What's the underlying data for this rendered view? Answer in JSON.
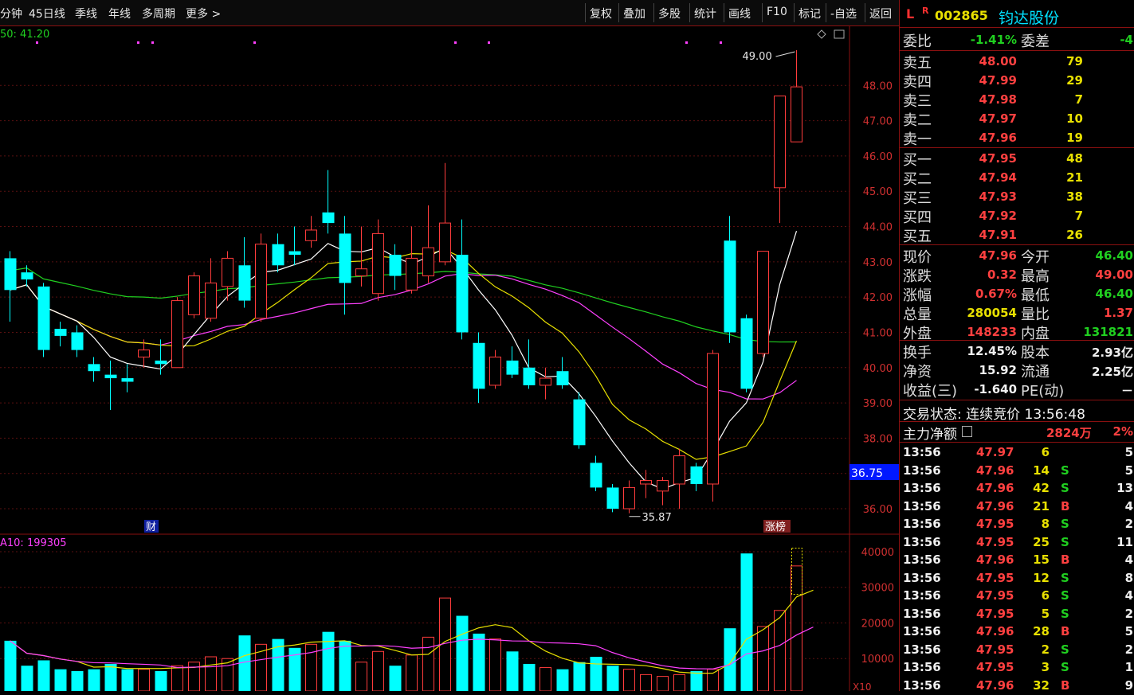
{
  "toolbar": {
    "left": [
      "分钟",
      "45日线",
      "季线",
      "年线",
      "多周期",
      "更多 >"
    ],
    "right": [
      "复权",
      "叠加",
      "多股",
      "统计",
      "画线",
      "F10",
      "标记",
      "-自选",
      "返回"
    ]
  },
  "chart": {
    "ma_label": "50: 41.20",
    "vol_label": "A10: 199305",
    "high_label": "49.00",
    "low_label": "35.87",
    "price_axis": [
      "48.00",
      "47.00",
      "46.00",
      "45.00",
      "44.00",
      "43.00",
      "42.00",
      "41.00",
      "40.00",
      "39.00",
      "38.00",
      "37.00",
      "36.00"
    ],
    "current_price_tag": "36.75",
    "vol_axis": [
      "40000",
      "30000",
      "20000",
      "10000"
    ],
    "vol_unit": "X10",
    "tag_cai": "财",
    "tag_zhangbang": "涨榜"
  },
  "chart_data": {
    "type": "candlestick",
    "candles": [
      {
        "o": 43.1,
        "c": 42.2,
        "h": 43.3,
        "l": 41.3
      },
      {
        "o": 42.7,
        "c": 42.5,
        "h": 42.9,
        "l": 42.3
      },
      {
        "o": 42.3,
        "c": 40.5,
        "h": 42.4,
        "l": 40.3
      },
      {
        "o": 41.1,
        "c": 40.9,
        "h": 41.3,
        "l": 40.6
      },
      {
        "o": 41.0,
        "c": 40.5,
        "h": 41.2,
        "l": 40.3
      },
      {
        "o": 40.1,
        "c": 39.9,
        "h": 40.3,
        "l": 39.6
      },
      {
        "o": 39.8,
        "c": 39.7,
        "h": 40.2,
        "l": 38.8
      },
      {
        "o": 39.7,
        "c": 39.6,
        "h": 40.1,
        "l": 39.3
      },
      {
        "o": 40.3,
        "c": 40.5,
        "h": 40.8,
        "l": 40.0
      },
      {
        "o": 40.2,
        "c": 40.1,
        "h": 40.8,
        "l": 39.8
      },
      {
        "o": 40.0,
        "c": 41.9,
        "h": 42.0,
        "l": 40.0
      },
      {
        "o": 41.5,
        "c": 42.6,
        "h": 42.7,
        "l": 41.4
      },
      {
        "o": 41.4,
        "c": 42.4,
        "h": 43.1,
        "l": 41.3
      },
      {
        "o": 42.3,
        "c": 43.1,
        "h": 43.3,
        "l": 41.9
      },
      {
        "o": 42.9,
        "c": 41.9,
        "h": 43.7,
        "l": 41.7
      },
      {
        "o": 41.4,
        "c": 43.5,
        "h": 43.8,
        "l": 41.3
      },
      {
        "o": 43.5,
        "c": 42.9,
        "h": 43.8,
        "l": 42.7
      },
      {
        "o": 43.3,
        "c": 43.2,
        "h": 44.0,
        "l": 42.9
      },
      {
        "o": 43.6,
        "c": 43.9,
        "h": 44.3,
        "l": 43.4
      },
      {
        "o": 44.4,
        "c": 44.1,
        "h": 45.6,
        "l": 43.8
      },
      {
        "o": 43.8,
        "c": 42.4,
        "h": 44.3,
        "l": 41.5
      },
      {
        "o": 42.6,
        "c": 42.8,
        "h": 44.0,
        "l": 42.3
      },
      {
        "o": 42.1,
        "c": 43.8,
        "h": 44.2,
        "l": 41.9
      },
      {
        "o": 43.2,
        "c": 42.6,
        "h": 43.5,
        "l": 42.2
      },
      {
        "o": 42.2,
        "c": 43.1,
        "h": 44.0,
        "l": 42.1
      },
      {
        "o": 42.6,
        "c": 43.4,
        "h": 44.6,
        "l": 42.4
      },
      {
        "o": 43.0,
        "c": 44.1,
        "h": 45.8,
        "l": 42.9
      },
      {
        "o": 43.2,
        "c": 41.0,
        "h": 44.2,
        "l": 40.8
      },
      {
        "o": 40.7,
        "c": 39.4,
        "h": 41.0,
        "l": 39.0
      },
      {
        "o": 39.5,
        "c": 40.3,
        "h": 40.5,
        "l": 39.4
      },
      {
        "o": 40.2,
        "c": 39.8,
        "h": 40.6,
        "l": 39.7
      },
      {
        "o": 40.0,
        "c": 39.5,
        "h": 40.8,
        "l": 39.4
      },
      {
        "o": 39.5,
        "c": 39.7,
        "h": 40.0,
        "l": 39.1
      },
      {
        "o": 39.9,
        "c": 39.5,
        "h": 40.3,
        "l": 39.4
      },
      {
        "o": 39.1,
        "c": 37.8,
        "h": 39.3,
        "l": 37.7
      },
      {
        "o": 37.3,
        "c": 36.6,
        "h": 37.5,
        "l": 36.5
      },
      {
        "o": 36.6,
        "c": 36.0,
        "h": 36.7,
        "l": 35.9
      },
      {
        "o": 36.0,
        "c": 36.6,
        "h": 36.8,
        "l": 35.87
      },
      {
        "o": 36.7,
        "c": 36.8,
        "h": 37.1,
        "l": 36.3
      },
      {
        "o": 36.5,
        "c": 36.8,
        "h": 36.9,
        "l": 36.1
      },
      {
        "o": 36.7,
        "c": 37.5,
        "h": 37.7,
        "l": 36.0
      },
      {
        "o": 37.2,
        "c": 36.7,
        "h": 37.3,
        "l": 36.5
      },
      {
        "o": 36.7,
        "c": 40.4,
        "h": 40.5,
        "l": 36.2
      },
      {
        "o": 43.6,
        "c": 41.0,
        "h": 44.3,
        "l": 40.7
      },
      {
        "o": 41.4,
        "c": 39.4,
        "h": 41.5,
        "l": 39.3
      },
      {
        "o": 40.4,
        "c": 43.3,
        "h": 43.3,
        "l": 40.3
      },
      {
        "o": 45.1,
        "c": 47.7,
        "h": 47.7,
        "l": 44.1
      },
      {
        "o": 46.4,
        "c": 47.96,
        "h": 49.0,
        "l": 46.4
      }
    ],
    "volumes": [
      15000,
      8000,
      9500,
      7000,
      6500,
      7000,
      8500,
      7000,
      7000,
      6500,
      8000,
      9000,
      10500,
      10000,
      16500,
      14000,
      15500,
      13000,
      14000,
      17500,
      15000,
      9000,
      12000,
      8000,
      11000,
      16000,
      27000,
      22000,
      17000,
      15500,
      12000,
      8500,
      7500,
      7000,
      9000,
      10500,
      8000,
      7000,
      5500,
      5000,
      5500,
      6500,
      7000,
      18500,
      39500,
      19000,
      23500,
      36000,
      28000
    ],
    "ylim": [
      35.5,
      49.5
    ],
    "vol_ylim": [
      0,
      42000
    ]
  },
  "panel": {
    "header_l": "L",
    "header_r": "R",
    "code": "002865",
    "name": "钧达股份",
    "weibi_label": "委比",
    "weibi_value": "-1.41%",
    "weicha_label": "委差",
    "weicha_value": "-4",
    "sells": [
      {
        "label": "卖五",
        "price": "48.00",
        "vol": "79"
      },
      {
        "label": "卖四",
        "price": "47.99",
        "vol": "29"
      },
      {
        "label": "卖三",
        "price": "47.98",
        "vol": "7"
      },
      {
        "label": "卖二",
        "price": "47.97",
        "vol": "10"
      },
      {
        "label": "卖一",
        "price": "47.96",
        "vol": "19"
      }
    ],
    "buys": [
      {
        "label": "买一",
        "price": "47.95",
        "vol": "48"
      },
      {
        "label": "买二",
        "price": "47.94",
        "vol": "21"
      },
      {
        "label": "买三",
        "price": "47.93",
        "vol": "38"
      },
      {
        "label": "买四",
        "price": "47.92",
        "vol": "7"
      },
      {
        "label": "买五",
        "price": "47.91",
        "vol": "26"
      }
    ],
    "stats": [
      {
        "l1": "现价",
        "v1": "47.96",
        "c1": "red",
        "l2": "今开",
        "v2": "46.40",
        "c2": "grn"
      },
      {
        "l1": "涨跌",
        "v1": "0.32",
        "c1": "red",
        "l2": "最高",
        "v2": "49.00",
        "c2": "red"
      },
      {
        "l1": "涨幅",
        "v1": "0.67%",
        "c1": "red",
        "l2": "最低",
        "v2": "46.40",
        "c2": "grn"
      },
      {
        "l1": "总量",
        "v1": "280054",
        "c1": "yel",
        "l2": "量比",
        "v2": "1.37",
        "c2": "red"
      },
      {
        "l1": "外盘",
        "v1": "148233",
        "c1": "red",
        "l2": "内盘",
        "v2": "131821",
        "c2": "grn"
      }
    ],
    "stats2": [
      {
        "l1": "换手",
        "v1": "12.45%",
        "l2": "股本",
        "v2": "2.93亿"
      },
      {
        "l1": "净资",
        "v1": "15.92",
        "l2": "流通",
        "v2": "2.25亿"
      },
      {
        "l1": "收益(三)",
        "v1": "-1.640",
        "l2": "PE(动)",
        "v2": "－"
      }
    ],
    "trade_status": "交易状态: 连续竞价 13:56:48",
    "mainflow_label": "主力净额",
    "mainflow_value": "2824万",
    "mainflow_pct": "2%",
    "ticks": [
      {
        "t": "13:56",
        "p": "47.97",
        "v": "6",
        "bs": "",
        "n": "5"
      },
      {
        "t": "13:56",
        "p": "47.96",
        "v": "14",
        "bs": "S",
        "n": "5"
      },
      {
        "t": "13:56",
        "p": "47.96",
        "v": "42",
        "bs": "S",
        "n": "13"
      },
      {
        "t": "13:56",
        "p": "47.96",
        "v": "21",
        "bs": "B",
        "n": "4"
      },
      {
        "t": "13:56",
        "p": "47.95",
        "v": "8",
        "bs": "S",
        "n": "2"
      },
      {
        "t": "13:56",
        "p": "47.95",
        "v": "25",
        "bs": "S",
        "n": "11"
      },
      {
        "t": "13:56",
        "p": "47.96",
        "v": "15",
        "bs": "B",
        "n": "4"
      },
      {
        "t": "13:56",
        "p": "47.95",
        "v": "12",
        "bs": "S",
        "n": "8"
      },
      {
        "t": "13:56",
        "p": "47.95",
        "v": "6",
        "bs": "S",
        "n": "4"
      },
      {
        "t": "13:56",
        "p": "47.95",
        "v": "5",
        "bs": "S",
        "n": "2"
      },
      {
        "t": "13:56",
        "p": "47.96",
        "v": "28",
        "bs": "B",
        "n": "5"
      },
      {
        "t": "13:56",
        "p": "47.95",
        "v": "2",
        "bs": "S",
        "n": "2"
      },
      {
        "t": "13:56",
        "p": "47.95",
        "v": "3",
        "bs": "S",
        "n": "1"
      },
      {
        "t": "13:56",
        "p": "47.96",
        "v": "32",
        "bs": "B",
        "n": "9"
      }
    ],
    "colors": {
      "up": "#ff3c3c",
      "down": "#00ffff",
      "ma5": "#ffffff",
      "ma10": "#e8e000",
      "ma20": "#ff40ff",
      "ma60": "#20d020"
    }
  }
}
